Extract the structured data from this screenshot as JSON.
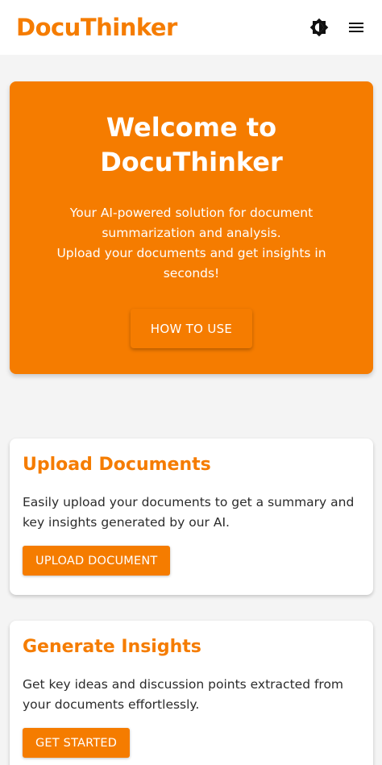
{
  "header": {
    "brand": "DocuThinker",
    "theme_toggle_icon": "brightness-icon",
    "menu_icon": "hamburger-menu-icon"
  },
  "hero": {
    "title": "Welcome to DocuThinker",
    "text_line1": "Your AI-powered solution for document summarization and analysis.",
    "text_line2": "Upload your documents and get insights in seconds!",
    "button_label": "HOW TO USE"
  },
  "cards": [
    {
      "title": "Upload Documents",
      "text": "Easily upload your documents to get a summary and key insights generated by our AI.",
      "button_label": "UPLOAD DOCUMENT"
    },
    {
      "title": "Generate Insights",
      "text": "Get key ideas and discussion points extracted from your documents effortlessly.",
      "button_label": "GET STARTED"
    }
  ],
  "colors": {
    "accent": "#f57c00",
    "background": "#f4f4f4",
    "card": "#ffffff"
  }
}
